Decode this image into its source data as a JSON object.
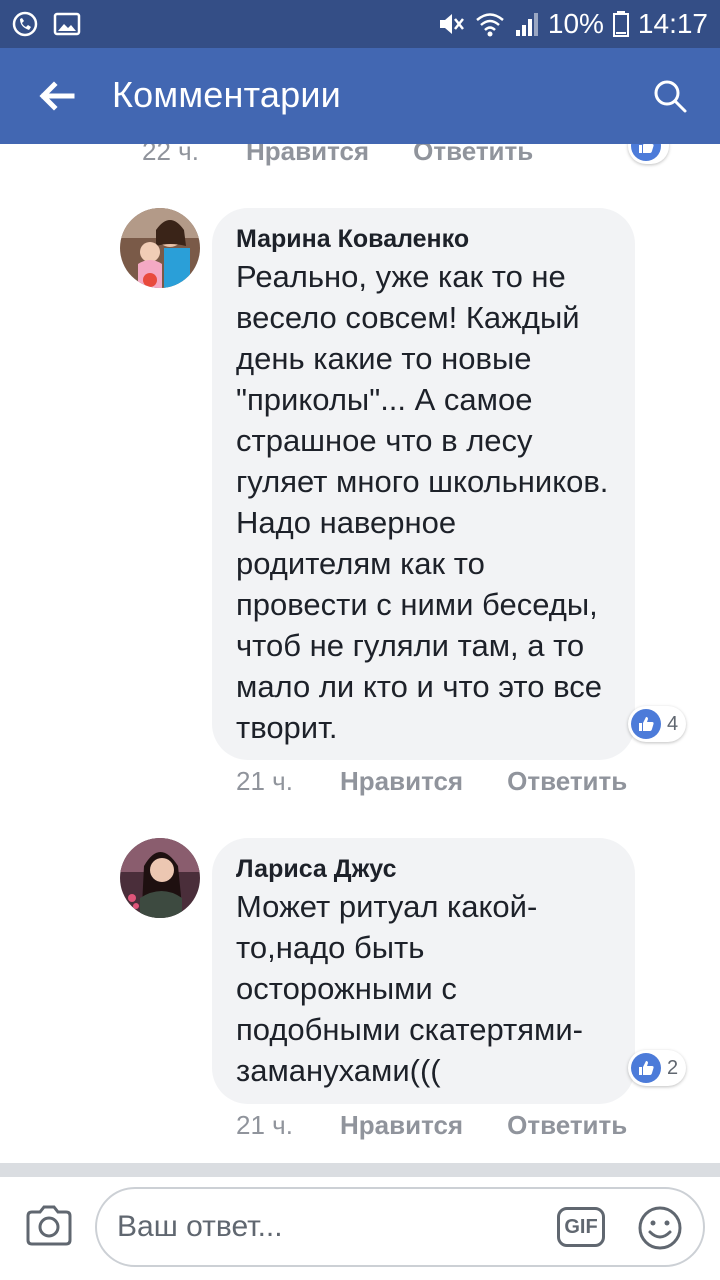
{
  "status_bar": {
    "battery": "10%",
    "time": "14:17",
    "icons": [
      "viber-icon",
      "gallery-icon",
      "mute-icon",
      "wifi-icon",
      "signal-icon",
      "battery-icon"
    ]
  },
  "app_bar": {
    "title": "Комментарии",
    "back_icon": "arrow-left-icon",
    "search_icon": "search-icon"
  },
  "previous_comment_meta": {
    "time": "22 ч.",
    "like_label": "Нравится",
    "reply_label": "Ответить"
  },
  "comments": [
    {
      "author": "Марина Коваленко",
      "text": "Реально, уже как то не весело совсем! Каждый день какие то новые \"приколы\"... А самое страшное что в лесу гуляет много школьников. Надо наверное родителям как то провести с ними беседы, чтоб не гуляли там, а то мало ли кто и что это все творит.",
      "likes": "4",
      "time": "21 ч.",
      "like_label": "Нравится",
      "reply_label": "Ответить"
    },
    {
      "author": "Лариса Джус",
      "text": "Может ритуал какой-то,надо быть осторожными с подобными скатертями-заманухами(((",
      "likes": "2",
      "time": "21 ч.",
      "like_label": "Нравится",
      "reply_label": "Ответить"
    }
  ],
  "composer": {
    "placeholder": "Ваш ответ...",
    "gif_label": "GIF"
  },
  "colors": {
    "status_bar": "#344e86",
    "app_bar": "#4267b2",
    "bubble": "#f2f3f5",
    "like_badge": "#4c7bd9",
    "meta_text": "#90949c"
  }
}
